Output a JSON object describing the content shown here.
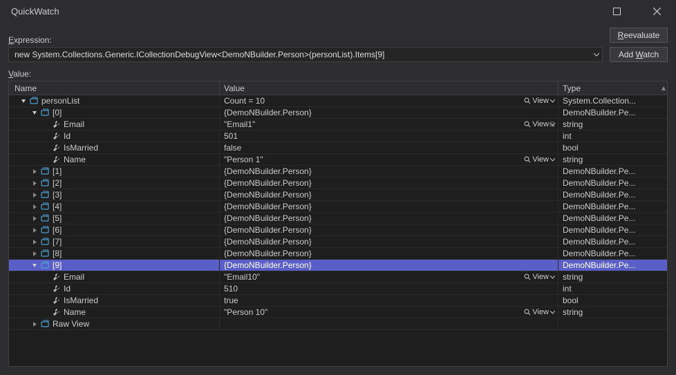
{
  "window": {
    "title": "QuickWatch"
  },
  "labels": {
    "expression": "Expression:",
    "value": "Value:"
  },
  "buttons": {
    "reevaluate": "Reevaluate",
    "addwatch": "Add Watch"
  },
  "expression": "new System.Collections.Generic.ICollectionDebugView<DemoNBuilder.Person>(personList).Items[9]",
  "columns": {
    "name": "Name",
    "value": "Value",
    "type": "Type"
  },
  "viewLabel": "View",
  "rows": [
    {
      "depth": 0,
      "expand": "open",
      "icon": "obj",
      "name": "personList",
      "value": "Count = 10",
      "type": "System.Collection...",
      "view": true
    },
    {
      "depth": 1,
      "expand": "open",
      "icon": "obj",
      "name": "[0]",
      "value": "{DemoNBuilder.Person}",
      "type": "DemoNBuilder.Pe..."
    },
    {
      "depth": 2,
      "expand": "none",
      "icon": "wrench",
      "name": "Email",
      "value": "\"Email1\"",
      "type": "string",
      "view": true,
      "pin": true
    },
    {
      "depth": 2,
      "expand": "none",
      "icon": "wrench",
      "name": "Id",
      "value": "501",
      "type": "int"
    },
    {
      "depth": 2,
      "expand": "none",
      "icon": "wrench",
      "name": "IsMarried",
      "value": "false",
      "type": "bool"
    },
    {
      "depth": 2,
      "expand": "none",
      "icon": "wrench",
      "name": "Name",
      "value": "\"Person 1\"",
      "type": "string",
      "view": true
    },
    {
      "depth": 1,
      "expand": "closed",
      "icon": "obj",
      "name": "[1]",
      "value": "{DemoNBuilder.Person}",
      "type": "DemoNBuilder.Pe..."
    },
    {
      "depth": 1,
      "expand": "closed",
      "icon": "obj",
      "name": "[2]",
      "value": "{DemoNBuilder.Person}",
      "type": "DemoNBuilder.Pe..."
    },
    {
      "depth": 1,
      "expand": "closed",
      "icon": "obj",
      "name": "[3]",
      "value": "{DemoNBuilder.Person}",
      "type": "DemoNBuilder.Pe..."
    },
    {
      "depth": 1,
      "expand": "closed",
      "icon": "obj",
      "name": "[4]",
      "value": "{DemoNBuilder.Person}",
      "type": "DemoNBuilder.Pe..."
    },
    {
      "depth": 1,
      "expand": "closed",
      "icon": "obj",
      "name": "[5]",
      "value": "{DemoNBuilder.Person}",
      "type": "DemoNBuilder.Pe..."
    },
    {
      "depth": 1,
      "expand": "closed",
      "icon": "obj",
      "name": "[6]",
      "value": "{DemoNBuilder.Person}",
      "type": "DemoNBuilder.Pe..."
    },
    {
      "depth": 1,
      "expand": "closed",
      "icon": "obj",
      "name": "[7]",
      "value": "{DemoNBuilder.Person}",
      "type": "DemoNBuilder.Pe..."
    },
    {
      "depth": 1,
      "expand": "closed",
      "icon": "obj",
      "name": "[8]",
      "value": "{DemoNBuilder.Person}",
      "type": "DemoNBuilder.Pe..."
    },
    {
      "depth": 1,
      "expand": "open",
      "icon": "obj",
      "name": "[9]",
      "value": "{DemoNBuilder.Person}",
      "type": "DemoNBuilder.Pe...",
      "selected": true
    },
    {
      "depth": 2,
      "expand": "none",
      "icon": "wrench",
      "name": "Email",
      "value": "\"Email10\"",
      "type": "string",
      "view": true
    },
    {
      "depth": 2,
      "expand": "none",
      "icon": "wrench",
      "name": "Id",
      "value": "510",
      "type": "int"
    },
    {
      "depth": 2,
      "expand": "none",
      "icon": "wrench",
      "name": "IsMarried",
      "value": "true",
      "type": "bool"
    },
    {
      "depth": 2,
      "expand": "none",
      "icon": "wrench",
      "name": "Name",
      "value": "\"Person 10\"",
      "type": "string",
      "view": true
    },
    {
      "depth": 1,
      "expand": "closed",
      "icon": "obj",
      "name": "Raw View",
      "value": "",
      "type": ""
    }
  ]
}
